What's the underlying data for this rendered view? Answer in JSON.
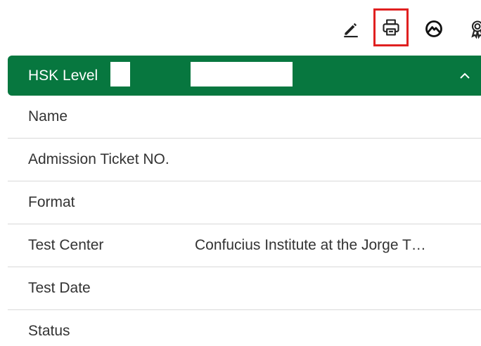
{
  "toolbar": {
    "icons": [
      "edit-icon",
      "print-icon",
      "mountain-icon",
      "award-icon"
    ],
    "highlighted": "print-icon",
    "highlight_color": "#e02020"
  },
  "card": {
    "header_label": "HSK Level",
    "header_color": "#07773f",
    "expanded": true,
    "rows": [
      {
        "label": "Name",
        "value": ""
      },
      {
        "label": "Admission Ticket NO.",
        "value": ""
      },
      {
        "label": "Format",
        "value": ""
      },
      {
        "label": "Test Center",
        "value": "Confucius Institute at the Jorge T…"
      },
      {
        "label": "Test Date",
        "value": ""
      },
      {
        "label": "Status",
        "value": ""
      }
    ]
  }
}
